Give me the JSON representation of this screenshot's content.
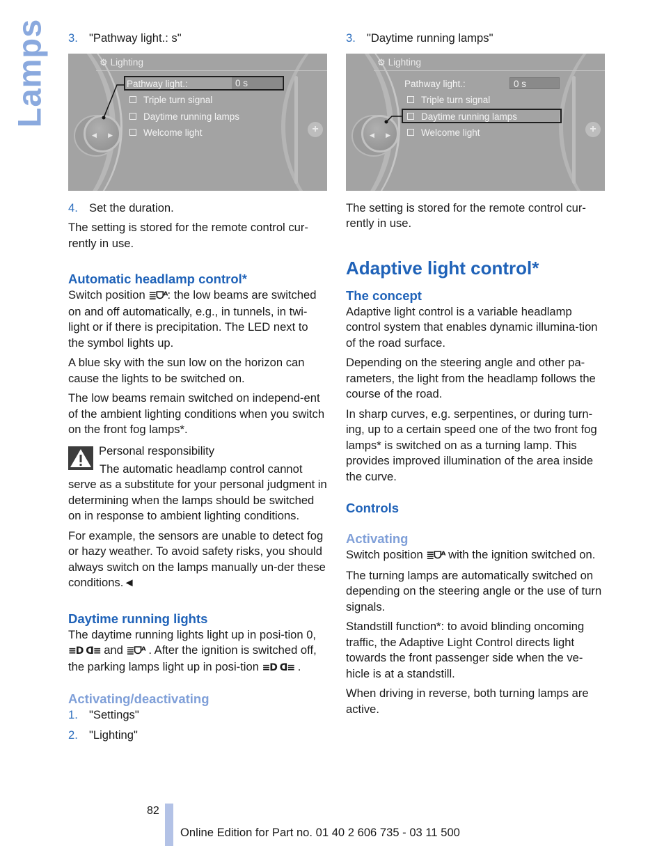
{
  "side_tab": "Lamps",
  "left_column": {
    "step3": {
      "num": "3.",
      "text": "\"Pathway light.: s\""
    },
    "screen": {
      "title": "Lighting",
      "rows": [
        {
          "label": "Pathway light.:",
          "value": "0 s"
        },
        {
          "label": "Triple turn signal"
        },
        {
          "label": "Daytime running lamps"
        },
        {
          "label": "Welcome light"
        }
      ],
      "highlighted": "Pathway light.:"
    },
    "step4": {
      "num": "4.",
      "text": "Set the duration."
    },
    "stored_note": "The setting is stored for the remote control cur-rently in use.",
    "auto_headlamp": {
      "heading": "Automatic headlamp control*",
      "p1_pre": "Switch position",
      "p1_post": ": the low beams are switched on and off automatically, e.g., in tunnels, in twi-light or if there is precipitation. The LED next to the symbol lights up.",
      "p2": "A blue sky with the sun low on the horizon can cause the lights to be switched on.",
      "p3": "The low beams remain switched on independ-ent of the ambient lighting conditions when you switch on the front fog lamps*.",
      "warning_title": "Personal responsibility",
      "warning_text": "The automatic headlamp control cannot serve as a substitute for your personal judgment in determining when the lamps should be switched on in response to ambient lighting conditions.",
      "p4": "For example, the sensors are unable to detect fog or hazy weather. To avoid safety risks, you should always switch on the lamps manually un-der these conditions.◄"
    },
    "daytime": {
      "heading": "Daytime running lights",
      "p_a": "The daytime running lights light up in posi-tion 0,",
      "p_b": "and",
      "p_c": ". After the ignition is switched off, the parking lamps light up in posi-tion",
      "p_d": "."
    },
    "activating": {
      "heading": "Activating/deactivating",
      "steps": [
        {
          "num": "1.",
          "text": "\"Settings\""
        },
        {
          "num": "2.",
          "text": "\"Lighting\""
        }
      ]
    }
  },
  "right_column": {
    "step3": {
      "num": "3.",
      "text": "\"Daytime running lamps\""
    },
    "screen": {
      "title": "Lighting",
      "rows": [
        {
          "label": "Pathway light.:",
          "value": "0 s"
        },
        {
          "label": "Triple turn signal"
        },
        {
          "label": "Daytime running lamps"
        },
        {
          "label": "Welcome light"
        }
      ],
      "highlighted": "Daytime running lamps"
    },
    "stored_note": "The setting is stored for the remote control cur-rently in use.",
    "adaptive": {
      "heading": "Adaptive light control*",
      "concept_heading": "The concept",
      "concept_p1": "Adaptive light control is a variable headlamp control system that enables dynamic illumina-tion of the road surface.",
      "concept_p2": "Depending on the steering angle and other pa-rameters, the light from the headlamp follows the course of the road.",
      "concept_p3": "In sharp curves, e.g. serpentines, or during turn-ing, up to a certain speed one of the two front fog lamps* is switched on as a turning lamp. This provides improved illumination of the area inside the curve.",
      "controls_heading": "Controls",
      "activating_heading": "Activating",
      "act_p1_pre": "Switch position",
      "act_p1_post": "with the ignition switched on.",
      "act_p2": "The turning lamps are automatically switched on depending on the steering angle or the use of turn signals.",
      "act_p3": "Standstill function*: to avoid blinding oncoming traffic, the Adaptive Light Control directs light towards the front passenger side when the ve-hicle is at a standstill.",
      "act_p4": "When driving in reverse, both turning lamps are active."
    }
  },
  "icons": {
    "auto_headlight": "≣ᗜᴬ",
    "parking_lamps": "≡D ᗡ≡"
  },
  "footer": {
    "page_number": "82",
    "edition": "Online Edition for Part no. 01 40 2 606 735 - 03 11 500"
  },
  "colors": {
    "heading_blue": "#1f62b8",
    "subheading_light_blue": "#7f9fd8",
    "side_tab": "#8aa9de",
    "footer_bar": "#b3c2e6"
  }
}
